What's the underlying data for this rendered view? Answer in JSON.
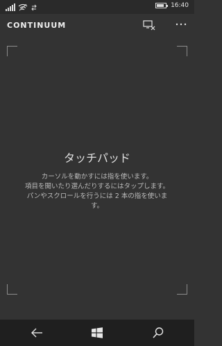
{
  "status_bar": {
    "time": "16:40",
    "icons": [
      "signal-icon",
      "wifi-icon",
      "sync-icon",
      "battery-icon"
    ],
    "battery_level": 0.85
  },
  "header": {
    "title": "CONTINUUM",
    "disconnect_icon": "disconnect-display-icon",
    "more_icon": "more-icon"
  },
  "touchpad": {
    "title": "タッチパッド",
    "instructions": [
      "カーソルを動かすには指を使います。",
      "項目を開いたり選んだりするにはタップします。",
      "パンやスクロールを行うには 2 本の指を使いま",
      "す。"
    ]
  },
  "nav_bar": {
    "icons": [
      "back-icon",
      "windows-start-icon",
      "search-icon"
    ]
  },
  "colors": {
    "background": "#333333",
    "status_bar": "#2a2a2a",
    "nav_bar": "#1f1f1f",
    "text_primary": "#e0e0e0",
    "text_secondary": "#bdbdbd",
    "corner_marks": "#8c8c8c"
  }
}
